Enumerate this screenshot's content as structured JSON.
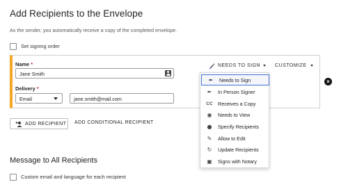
{
  "header": {
    "title": "Add Recipients to the Envelope",
    "subtitle": "As the sender, you automatically receive a copy of the completed envelope."
  },
  "signing_order": {
    "label": "Set signing order",
    "checked": false
  },
  "recipient": {
    "name_label": "Name",
    "name_value": "Jane Smith",
    "required_mark": "*",
    "delivery_label": "Delivery",
    "delivery_value": "Email",
    "email_value": "jane.smith@mail.com",
    "action_label": "NEEDS TO SIGN",
    "customize_label": "CUSTOMIZE",
    "accent_color": "#f5a623"
  },
  "actions": {
    "add_recipient": "ADD RECIPIENT",
    "add_conditional": "ADD CONDITIONAL RECIPIENT"
  },
  "message_section": {
    "title": "Message to All Recipients",
    "custom_email_label": "Custom email and language for each recipient"
  },
  "action_menu": {
    "items": [
      {
        "label": "Needs to Sign",
        "icon": "pen-icon",
        "selected": true
      },
      {
        "label": "In Person Signer",
        "icon": "pen-icon",
        "selected": false
      },
      {
        "label": "Receives a Copy",
        "icon": "cc-icon",
        "selected": false
      },
      {
        "label": "Needs to View",
        "icon": "eye-icon",
        "selected": false
      },
      {
        "label": "Specify Recipients",
        "icon": "person-icon",
        "selected": false
      },
      {
        "label": "Allow to Edit",
        "icon": "pencil-icon",
        "selected": false
      },
      {
        "label": "Update Recipients",
        "icon": "update-icon",
        "selected": false
      },
      {
        "label": "Signs with Notary",
        "icon": "notary-icon",
        "selected": false
      }
    ],
    "selected_color": "#3f6fd0"
  }
}
